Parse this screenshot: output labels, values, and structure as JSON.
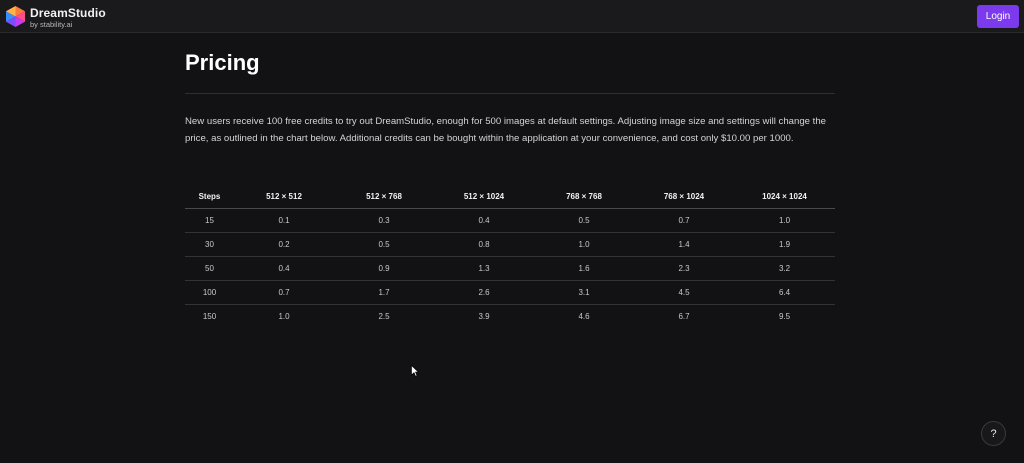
{
  "header": {
    "brand_name": "DreamStudio",
    "brand_sub": "by stability.ai",
    "login_label": "Login",
    "logo_icon": "hexagon-logo-icon",
    "accent_color": "#7c3aed"
  },
  "page": {
    "title": "Pricing",
    "intro": "New users receive 100 free credits to try out DreamStudio, enough for 500 images at default settings. Adjusting image size and settings will change the price, as outlined in the chart below. Additional credits can be bought within the application at your convenience, and cost only $10.00 per 1000."
  },
  "table": {
    "headers": [
      "Steps",
      "512 × 512",
      "512 × 768",
      "512 × 1024",
      "768 × 768",
      "768 × 1024",
      "1024 × 1024"
    ],
    "rows": [
      [
        "15",
        "0.1",
        "0.3",
        "0.4",
        "0.5",
        "0.7",
        "1.0"
      ],
      [
        "30",
        "0.2",
        "0.5",
        "0.8",
        "1.0",
        "1.4",
        "1.9"
      ],
      [
        "50",
        "0.4",
        "0.9",
        "1.3",
        "1.6",
        "2.3",
        "3.2"
      ],
      [
        "100",
        "0.7",
        "1.7",
        "2.6",
        "3.1",
        "4.5",
        "6.4"
      ],
      [
        "150",
        "1.0",
        "2.5",
        "3.9",
        "4.6",
        "6.7",
        "9.5"
      ]
    ]
  },
  "help": {
    "label": "?",
    "icon": "question-mark-icon"
  }
}
